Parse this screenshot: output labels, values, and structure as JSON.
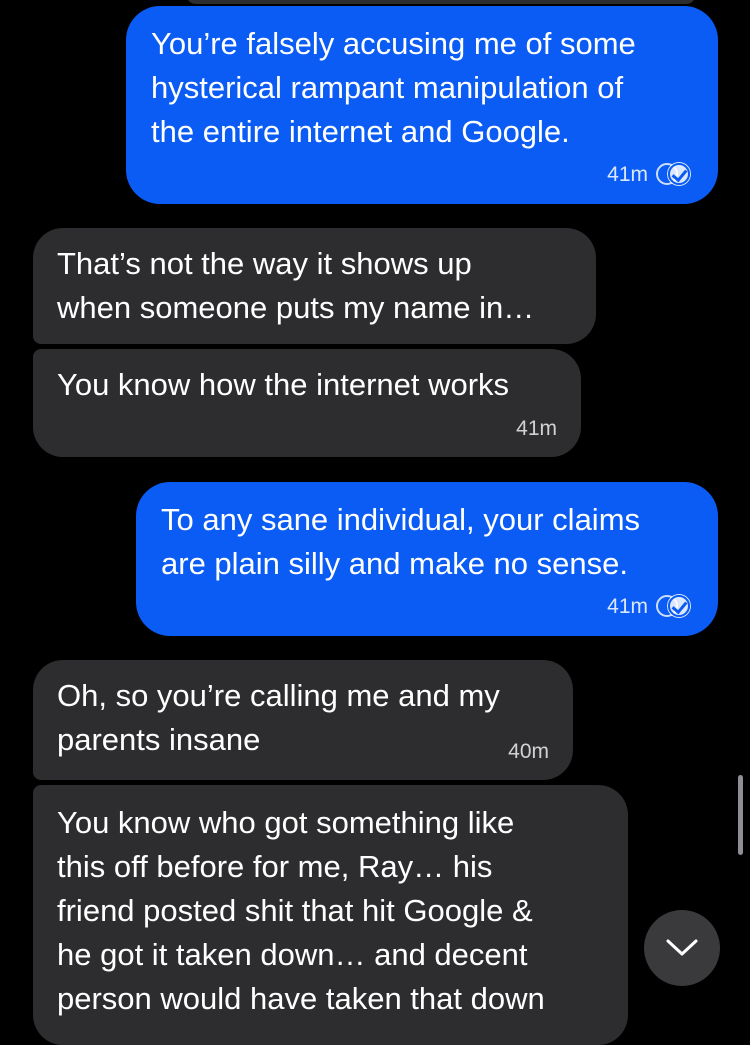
{
  "messages": [
    {
      "direction": "outgoing",
      "text": "You’re falsely accusing me of some\nhysterical rampant manipulation of\nthe entire internet and Google.",
      "time": "41m",
      "status_icon": "seen-check-icon"
    },
    {
      "direction": "incoming",
      "text": "That’s not the way it shows up\nwhen someone puts my name in…",
      "time": ""
    },
    {
      "direction": "incoming",
      "text": "You know how the internet works",
      "time": "41m"
    },
    {
      "direction": "outgoing",
      "text": "To any sane individual, your claims\nare plain silly and make no sense.",
      "time": "41m",
      "status_icon": "seen-check-icon"
    },
    {
      "direction": "incoming",
      "text": "Oh, so you’re calling me and my\nparents insane",
      "time": "40m"
    },
    {
      "direction": "incoming",
      "text": "You know who got something like\nthis off before for me, Ray… his\nfriend posted shit that hit Google &\nhe got it taken down… and decent\nperson would have taken that down",
      "time": ""
    }
  ],
  "controls": {
    "scroll_down_icon": "chevron-down-icon"
  },
  "colors": {
    "background": "#000000",
    "outgoing_bubble": "#0a5cf5",
    "incoming_bubble": "#2d2d2f",
    "text": "#ffffff"
  }
}
